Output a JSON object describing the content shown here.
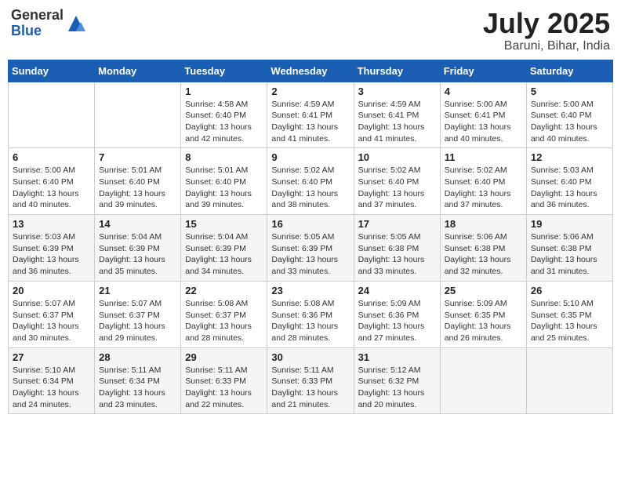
{
  "header": {
    "logo_general": "General",
    "logo_blue": "Blue",
    "month_title": "July 2025",
    "location": "Baruni, Bihar, India"
  },
  "weekdays": [
    "Sunday",
    "Monday",
    "Tuesday",
    "Wednesday",
    "Thursday",
    "Friday",
    "Saturday"
  ],
  "weeks": [
    [
      {
        "day": "",
        "info": ""
      },
      {
        "day": "",
        "info": ""
      },
      {
        "day": "1",
        "info": "Sunrise: 4:58 AM\nSunset: 6:40 PM\nDaylight: 13 hours and 42 minutes."
      },
      {
        "day": "2",
        "info": "Sunrise: 4:59 AM\nSunset: 6:41 PM\nDaylight: 13 hours and 41 minutes."
      },
      {
        "day": "3",
        "info": "Sunrise: 4:59 AM\nSunset: 6:41 PM\nDaylight: 13 hours and 41 minutes."
      },
      {
        "day": "4",
        "info": "Sunrise: 5:00 AM\nSunset: 6:41 PM\nDaylight: 13 hours and 40 minutes."
      },
      {
        "day": "5",
        "info": "Sunrise: 5:00 AM\nSunset: 6:40 PM\nDaylight: 13 hours and 40 minutes."
      }
    ],
    [
      {
        "day": "6",
        "info": "Sunrise: 5:00 AM\nSunset: 6:40 PM\nDaylight: 13 hours and 40 minutes."
      },
      {
        "day": "7",
        "info": "Sunrise: 5:01 AM\nSunset: 6:40 PM\nDaylight: 13 hours and 39 minutes."
      },
      {
        "day": "8",
        "info": "Sunrise: 5:01 AM\nSunset: 6:40 PM\nDaylight: 13 hours and 39 minutes."
      },
      {
        "day": "9",
        "info": "Sunrise: 5:02 AM\nSunset: 6:40 PM\nDaylight: 13 hours and 38 minutes."
      },
      {
        "day": "10",
        "info": "Sunrise: 5:02 AM\nSunset: 6:40 PM\nDaylight: 13 hours and 37 minutes."
      },
      {
        "day": "11",
        "info": "Sunrise: 5:02 AM\nSunset: 6:40 PM\nDaylight: 13 hours and 37 minutes."
      },
      {
        "day": "12",
        "info": "Sunrise: 5:03 AM\nSunset: 6:40 PM\nDaylight: 13 hours and 36 minutes."
      }
    ],
    [
      {
        "day": "13",
        "info": "Sunrise: 5:03 AM\nSunset: 6:39 PM\nDaylight: 13 hours and 36 minutes."
      },
      {
        "day": "14",
        "info": "Sunrise: 5:04 AM\nSunset: 6:39 PM\nDaylight: 13 hours and 35 minutes."
      },
      {
        "day": "15",
        "info": "Sunrise: 5:04 AM\nSunset: 6:39 PM\nDaylight: 13 hours and 34 minutes."
      },
      {
        "day": "16",
        "info": "Sunrise: 5:05 AM\nSunset: 6:39 PM\nDaylight: 13 hours and 33 minutes."
      },
      {
        "day": "17",
        "info": "Sunrise: 5:05 AM\nSunset: 6:38 PM\nDaylight: 13 hours and 33 minutes."
      },
      {
        "day": "18",
        "info": "Sunrise: 5:06 AM\nSunset: 6:38 PM\nDaylight: 13 hours and 32 minutes."
      },
      {
        "day": "19",
        "info": "Sunrise: 5:06 AM\nSunset: 6:38 PM\nDaylight: 13 hours and 31 minutes."
      }
    ],
    [
      {
        "day": "20",
        "info": "Sunrise: 5:07 AM\nSunset: 6:37 PM\nDaylight: 13 hours and 30 minutes."
      },
      {
        "day": "21",
        "info": "Sunrise: 5:07 AM\nSunset: 6:37 PM\nDaylight: 13 hours and 29 minutes."
      },
      {
        "day": "22",
        "info": "Sunrise: 5:08 AM\nSunset: 6:37 PM\nDaylight: 13 hours and 28 minutes."
      },
      {
        "day": "23",
        "info": "Sunrise: 5:08 AM\nSunset: 6:36 PM\nDaylight: 13 hours and 28 minutes."
      },
      {
        "day": "24",
        "info": "Sunrise: 5:09 AM\nSunset: 6:36 PM\nDaylight: 13 hours and 27 minutes."
      },
      {
        "day": "25",
        "info": "Sunrise: 5:09 AM\nSunset: 6:35 PM\nDaylight: 13 hours and 26 minutes."
      },
      {
        "day": "26",
        "info": "Sunrise: 5:10 AM\nSunset: 6:35 PM\nDaylight: 13 hours and 25 minutes."
      }
    ],
    [
      {
        "day": "27",
        "info": "Sunrise: 5:10 AM\nSunset: 6:34 PM\nDaylight: 13 hours and 24 minutes."
      },
      {
        "day": "28",
        "info": "Sunrise: 5:11 AM\nSunset: 6:34 PM\nDaylight: 13 hours and 23 minutes."
      },
      {
        "day": "29",
        "info": "Sunrise: 5:11 AM\nSunset: 6:33 PM\nDaylight: 13 hours and 22 minutes."
      },
      {
        "day": "30",
        "info": "Sunrise: 5:11 AM\nSunset: 6:33 PM\nDaylight: 13 hours and 21 minutes."
      },
      {
        "day": "31",
        "info": "Sunrise: 5:12 AM\nSunset: 6:32 PM\nDaylight: 13 hours and 20 minutes."
      },
      {
        "day": "",
        "info": ""
      },
      {
        "day": "",
        "info": ""
      }
    ]
  ]
}
